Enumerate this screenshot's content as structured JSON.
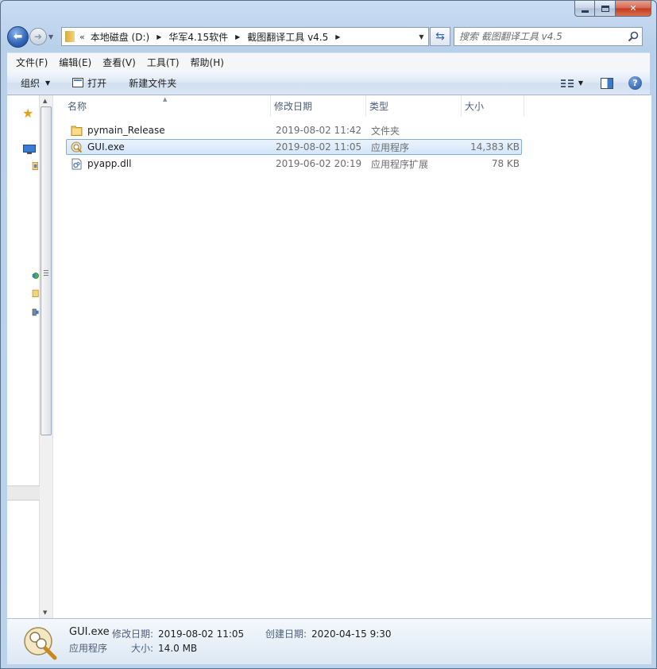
{
  "address": {
    "overflow": "«",
    "crumbs": [
      "本地磁盘 (D:)",
      "华军4.15软件",
      "截图翻译工具 v4.5"
    ]
  },
  "search": {
    "placeholder": "搜索 截图翻译工具 v4.5"
  },
  "menu": [
    "文件(F)",
    "编辑(E)",
    "查看(V)",
    "工具(T)",
    "帮助(H)"
  ],
  "commands": {
    "organize": "组织",
    "open": "打开",
    "new_folder": "新建文件夹"
  },
  "columns": {
    "name": "名称",
    "date": "修改日期",
    "type": "类型",
    "size": "大小"
  },
  "files": [
    {
      "name": "pymain_Release",
      "date": "2019-08-02 11:42",
      "type": "文件夹",
      "size": "",
      "icon": "folder-icon",
      "selected": false
    },
    {
      "name": "GUI.exe",
      "date": "2019-08-02 11:05",
      "type": "应用程序",
      "size": "14,383 KB",
      "icon": "exe-icon",
      "selected": true
    },
    {
      "name": "pyapp.dll",
      "date": "2019-06-02 20:19",
      "type": "应用程序扩展",
      "size": "78 KB",
      "icon": "dll-icon",
      "selected": false
    }
  ],
  "details": {
    "name": "GUI.exe",
    "modified_label": "修改日期:",
    "modified": "2019-08-02 11:05",
    "created_label": "创建日期:",
    "created": "2020-04-15 9:30",
    "type": "应用程序",
    "size_label": "大小:",
    "size": "14.0 MB"
  },
  "colors": {
    "selection": "#d3e6fa",
    "selection_border": "#84acdd",
    "accent": "#2f64b6"
  }
}
